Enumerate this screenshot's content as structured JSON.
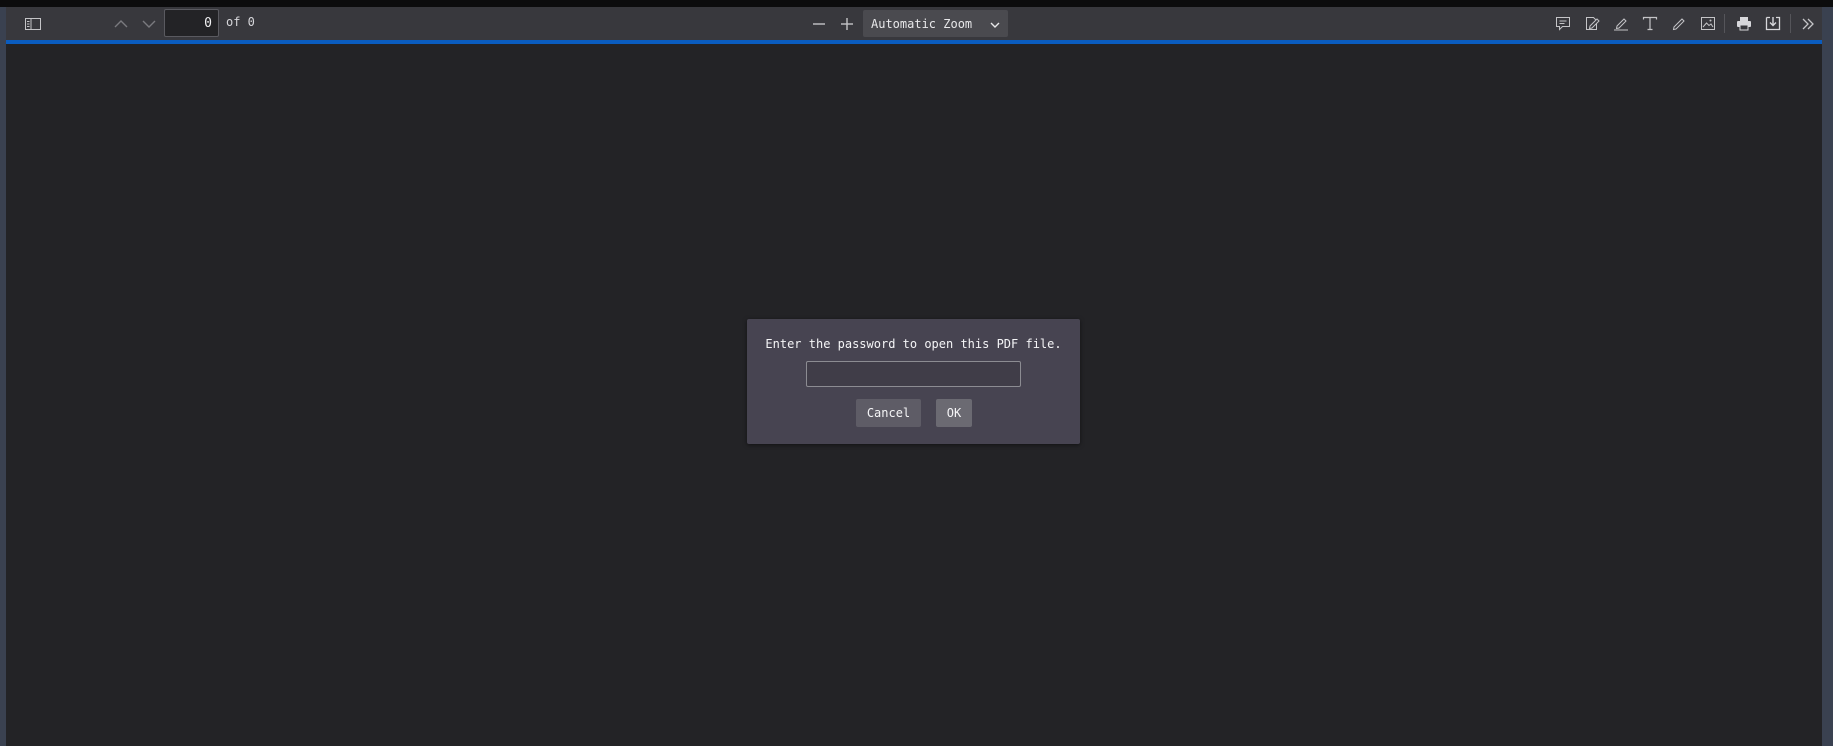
{
  "toolbar": {
    "sidebar_toggle_icon": "sidebar-icon",
    "prev_page_icon": "chevron-up-icon",
    "next_page_icon": "chevron-down-icon",
    "page_number": "0",
    "page_count": "of 0",
    "zoom_out_icon": "minus-icon",
    "zoom_in_icon": "plus-icon",
    "zoom_value": "Automatic Zoom",
    "right_tools": [
      "comment-icon",
      "signature-icon",
      "highlight-icon",
      "text-icon",
      "draw-icon",
      "image-icon",
      "print-icon",
      "save-icon",
      "more-tools-icon"
    ]
  },
  "dialog": {
    "message": "Enter the password to open this PDF file.",
    "password_value": "",
    "cancel_label": "Cancel",
    "ok_label": "OK"
  },
  "colors": {
    "toolbar_bg": "#38383d",
    "viewer_bg": "#232326",
    "loading_bar": "#0a5cbf",
    "dialog_bg": "#474451"
  }
}
